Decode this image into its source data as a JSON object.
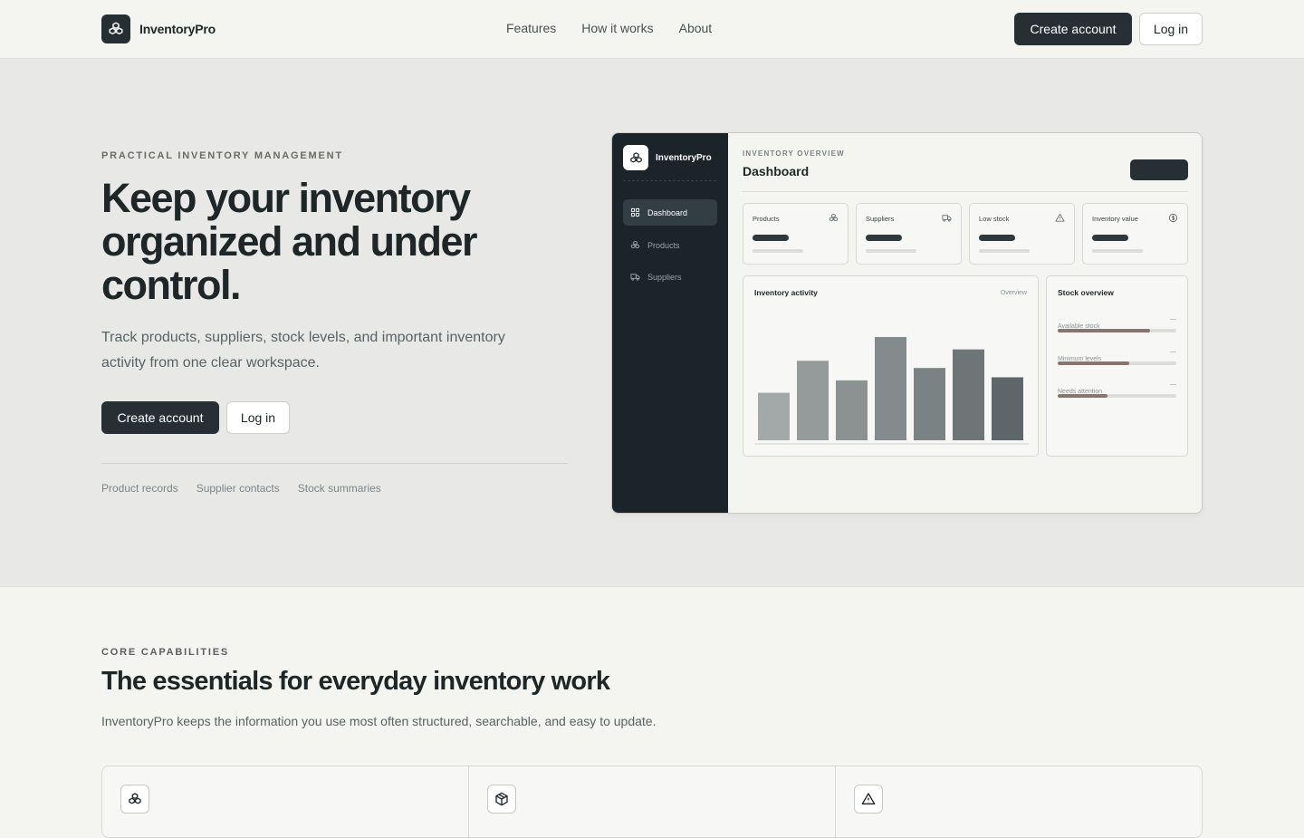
{
  "header": {
    "brand": "InventoryPro",
    "nav": [
      "Features",
      "How it works",
      "About"
    ],
    "create_label": "Create account",
    "login_label": "Log in"
  },
  "hero": {
    "eyebrow": "PRACTICAL INVENTORY MANAGEMENT",
    "title": "Keep your inventory organized and under control.",
    "description": "Track products, suppliers, stock levels, and important inventory activity from one clear workspace.",
    "create_label": "Create account",
    "login_label": "Log in",
    "tags": [
      "Product records",
      "Supplier contacts",
      "Stock summaries"
    ]
  },
  "mock": {
    "brand": "InventoryPro",
    "sidebar": [
      {
        "label": "Dashboard",
        "icon": "grid-icon"
      },
      {
        "label": "Products",
        "icon": "boxes-icon"
      },
      {
        "label": "Suppliers",
        "icon": "truck-icon"
      }
    ],
    "eyebrow": "INVENTORY OVERVIEW",
    "title": "Dashboard",
    "stats": [
      {
        "label": "Products",
        "icon": "boxes-icon"
      },
      {
        "label": "Suppliers",
        "icon": "truck-icon"
      },
      {
        "label": "Low stock",
        "icon": "warning-icon"
      },
      {
        "label": "Inventory value",
        "icon": "dollar-icon"
      }
    ],
    "activity": {
      "title": "Inventory activity",
      "hint": "Overview",
      "bar_levels": [
        0.46,
        0.77,
        0.58,
        1.0,
        0.7,
        0.88,
        0.61
      ],
      "bar_colors": [
        "#a3a8a8",
        "#959a9a",
        "#8c9292",
        "#848b8c",
        "#7a8283",
        "#6e7577",
        "#5d6669"
      ]
    },
    "stock_overview": {
      "title": "Stock overview",
      "rows": [
        {
          "label": "Available stock",
          "dash": "—",
          "level": 0.78
        },
        {
          "label": "Minimum levels",
          "dash": "—",
          "level": 0.6
        },
        {
          "label": "Needs attention",
          "dash": "—",
          "level": 0.42
        }
      ]
    }
  },
  "capabilities": {
    "eyebrow": "CORE CAPABILITIES",
    "title": "The essentials for everyday inventory work",
    "description": "InventoryPro keeps the information you use most often structured, searchable, and easy to update.",
    "cards": [
      {
        "icon": "boxes-icon"
      },
      {
        "icon": "package-icon"
      },
      {
        "icon": "warning-icon"
      }
    ]
  }
}
